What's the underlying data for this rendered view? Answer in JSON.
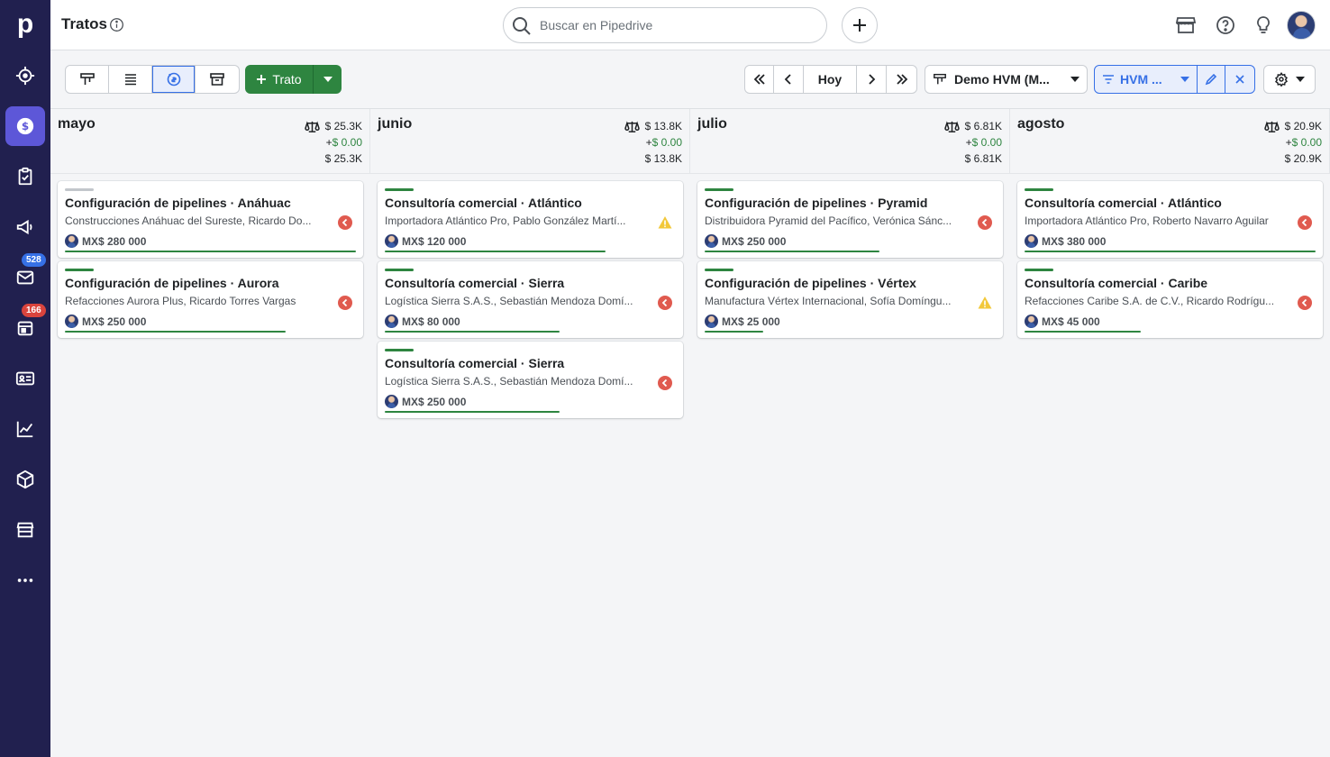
{
  "app": {
    "logo_letter": "p"
  },
  "sidebar": {
    "items": [
      {
        "name": "focus-icon"
      },
      {
        "name": "deals-icon",
        "active": true
      },
      {
        "name": "activities-icon"
      },
      {
        "name": "campaigns-icon"
      },
      {
        "name": "mail-icon",
        "badge": "528"
      },
      {
        "name": "calendar-icon",
        "badge": "166"
      },
      {
        "name": "contacts-icon"
      },
      {
        "name": "insights-icon"
      },
      {
        "name": "products-icon"
      },
      {
        "name": "marketplace-icon"
      },
      {
        "name": "more-icon"
      }
    ]
  },
  "header": {
    "title": "Tratos",
    "search_placeholder": "Buscar en Pipedrive"
  },
  "toolbar": {
    "add_deal_label": "Trato",
    "today_label": "Hoy",
    "pipeline_label": "Demo HVM (M...",
    "filter_label": "HVM ..."
  },
  "colors": {
    "sidebar_bg": "#21204f",
    "active_nav": "#5d57d8",
    "green": "#2e8540",
    "blue": "#3670e6",
    "red": "#e05a4f",
    "warning": "#f2c83a"
  },
  "columns": [
    {
      "title": "mayo",
      "weighted": "$ 25.3K",
      "plus_prefix": "+",
      "plus_value": "$ 0.00",
      "total": "$ 25.3K",
      "cards": [
        {
          "title": "Configuración de pipelines · Anáhuac",
          "org": "Construcciones Anáhuac del Sureste, Ricardo Do...",
          "value": "MX$ 280 000",
          "status": "overdue",
          "stage": "grey",
          "progress": 1.0
        },
        {
          "title": "Configuración de pipelines · Aurora",
          "org": "Refacciones Aurora Plus, Ricardo Torres Vargas",
          "value": "MX$ 250 000",
          "status": "overdue",
          "stage": "green",
          "progress": 0.76
        }
      ]
    },
    {
      "title": "junio",
      "weighted": "$ 13.8K",
      "plus_prefix": "+",
      "plus_value": "$ 0.00",
      "total": "$ 13.8K",
      "cards": [
        {
          "title": "Consultoría comercial · Atlántico",
          "org": "Importadora Atlántico Pro, Pablo González Martí...",
          "value": "MX$ 120 000",
          "status": "warning",
          "stage": "green",
          "progress": 0.76
        },
        {
          "title": "Consultoría comercial · Sierra",
          "org": "Logística Sierra S.A.S., Sebastián Mendoza Domí...",
          "value": "MX$ 80 000",
          "status": "overdue",
          "stage": "green",
          "progress": 0.6
        },
        {
          "title": "Consultoría comercial · Sierra",
          "org": "Logística Sierra S.A.S., Sebastián Mendoza Domí...",
          "value": "MX$ 250 000",
          "status": "overdue",
          "stage": "green",
          "progress": 0.6
        }
      ]
    },
    {
      "title": "julio",
      "weighted": "$ 6.81K",
      "plus_prefix": "+",
      "plus_value": "$ 0.00",
      "total": "$ 6.81K",
      "cards": [
        {
          "title": "Configuración de pipelines · Pyramid",
          "org": "Distribuidora Pyramid del Pacífico, Verónica Sánc...",
          "value": "MX$ 250 000",
          "status": "overdue",
          "stage": "green",
          "progress": 0.6
        },
        {
          "title": "Configuración de pipelines · Vértex",
          "org": "Manufactura Vértex Internacional, Sofía Domíngu...",
          "value": "MX$ 25 000",
          "status": "warning",
          "stage": "green",
          "progress": 0.2
        }
      ]
    },
    {
      "title": "agosto",
      "weighted": "$ 20.9K",
      "plus_prefix": "+",
      "plus_value": "$ 0.00",
      "total": "$ 20.9K",
      "cards": [
        {
          "title": "Consultoría comercial · Atlántico",
          "org": "Importadora Atlántico Pro, Roberto Navarro Aguilar",
          "value": "MX$ 380 000",
          "status": "overdue",
          "stage": "green",
          "progress": 1.0
        },
        {
          "title": "Consultoría comercial · Caribe",
          "org": "Refacciones Caribe S.A. de C.V., Ricardo Rodrígu...",
          "value": "MX$ 45 000",
          "status": "overdue",
          "stage": "green",
          "progress": 0.4
        }
      ]
    }
  ]
}
